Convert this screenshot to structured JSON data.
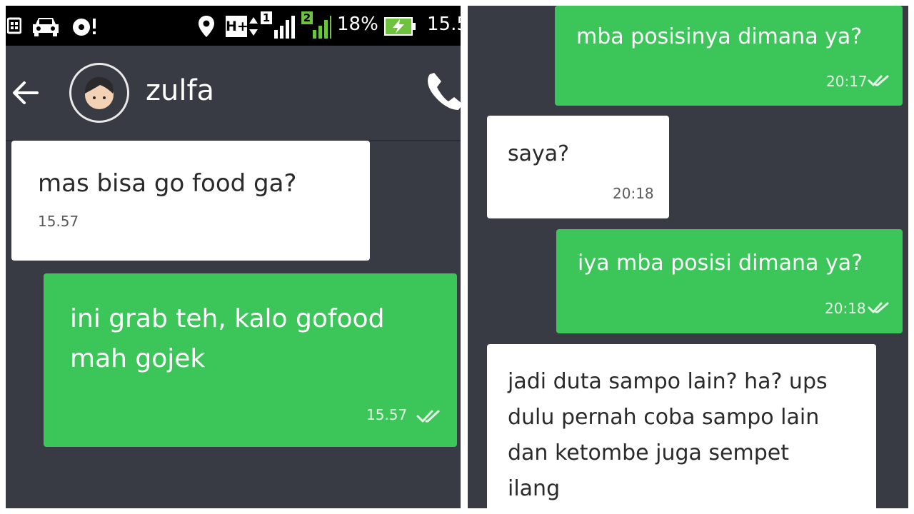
{
  "status_bar": {
    "network_type": "H+",
    "sim1": "1",
    "sim2": "2",
    "battery_percent": "18%",
    "clock_partial": "15.5"
  },
  "header": {
    "contact_name": "zulfa"
  },
  "left_messages": [
    {
      "direction": "incoming",
      "text": "mas bisa go food ga?",
      "time": "15.57"
    },
    {
      "direction": "outgoing",
      "text": "ini grab teh, kalo gofood\nmah gojek",
      "time": "15.57",
      "status": "read"
    }
  ],
  "right_messages": [
    {
      "direction": "outgoing",
      "text": "mba posisinya dimana ya?",
      "time": "20:17",
      "status": "read"
    },
    {
      "direction": "incoming",
      "text": "saya?",
      "time": "20:18"
    },
    {
      "direction": "outgoing",
      "text": "iya mba posisi dimana ya?",
      "time": "20:18",
      "status": "read"
    },
    {
      "direction": "incoming",
      "text": "jadi duta sampo lain? ha? ups\ndulu pernah coba sampo lain\ndan ketombe juga sempet\nilang",
      "time": ""
    }
  ],
  "colors": {
    "chat_background": "#393b44",
    "outgoing_bubble": "#3cc65a",
    "incoming_bubble": "#ffffff",
    "status_bar": "#000000"
  },
  "icons": [
    "notification-icon",
    "car-icon",
    "media-icon",
    "location-pin-icon",
    "signal-icon",
    "battery-charging-icon",
    "back-arrow-icon",
    "avatar",
    "phone-call-icon",
    "double-check-icon"
  ]
}
